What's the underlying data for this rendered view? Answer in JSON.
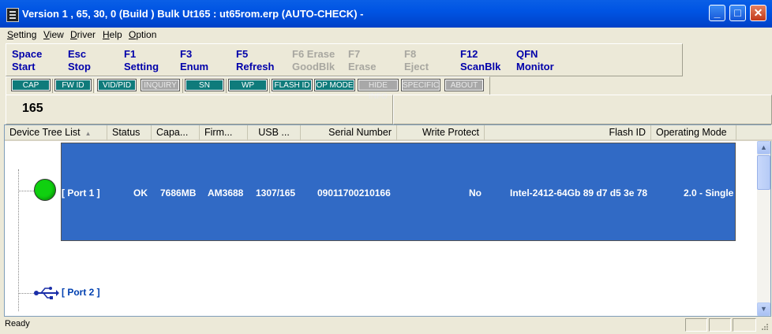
{
  "window": {
    "title": "Version 1 , 65, 30, 0 (Build )  Bulk Ut165 : ut65rom.erp  (AUTO-CHECK) -"
  },
  "menu": [
    "Setting",
    "View",
    "Driver",
    "Help",
    "Option"
  ],
  "commands": [
    {
      "key": "Space",
      "label": "Start",
      "enabled": true
    },
    {
      "key": "Esc",
      "label": "Stop",
      "enabled": true
    },
    {
      "key": "F1",
      "label": "Setting",
      "enabled": true
    },
    {
      "key": "F3",
      "label": "Enum",
      "enabled": true
    },
    {
      "key": "F5",
      "label": "Refresh",
      "enabled": true
    },
    {
      "key": "F6 Erase",
      "label": "GoodBlk",
      "enabled": false
    },
    {
      "key": "F7",
      "label": "Erase",
      "enabled": false
    },
    {
      "key": "F8",
      "label": "Eject",
      "enabled": false
    },
    {
      "key": "F12",
      "label": "ScanBlk",
      "enabled": true
    },
    {
      "key": "QFN",
      "label": "Monitor",
      "enabled": true
    }
  ],
  "toolbar_buttons": [
    {
      "label": "CAP",
      "enabled": true
    },
    {
      "label": "FW ID",
      "enabled": true
    },
    {
      "label": "VID/PID",
      "enabled": true
    },
    {
      "label": "INQUIRY",
      "enabled": false
    },
    {
      "label": "SN",
      "enabled": true
    },
    {
      "label": "WP",
      "enabled": true
    },
    {
      "label": "FLASH ID",
      "enabled": true
    },
    {
      "label": "OP MODE",
      "enabled": true
    },
    {
      "label": "HIDE INFO",
      "enabled": false
    },
    {
      "label": "SPECIFIC",
      "enabled": false
    },
    {
      "label": "ABOUT",
      "enabled": false
    }
  ],
  "count": "165",
  "columns": [
    "Device Tree List",
    "Status",
    "Capa...",
    "Firm...",
    "USB ...",
    "Serial Number",
    "Write Protect",
    "Flash ID",
    "Operating Mode"
  ],
  "rows": [
    {
      "port": "[ Port  1 ]",
      "status": "OK",
      "capacity": "7686MB",
      "firmware": "AM3688",
      "usb": "1307/165",
      "serial": "09011700210166",
      "write_protect": "No",
      "flash_id": "Intel-2412-64Gb 89 d7 d5 3e 78",
      "operating_mode": "2.0 - Single",
      "indicator_color": "#10D010"
    },
    {
      "port": "[ Port  2 ]"
    }
  ],
  "status_bar": {
    "text": "Ready"
  },
  "colors": {
    "selection": "#316AC5",
    "titlebar": "#0054E3",
    "command_text": "#0000AA",
    "button_teal": "#0F7B7B"
  }
}
